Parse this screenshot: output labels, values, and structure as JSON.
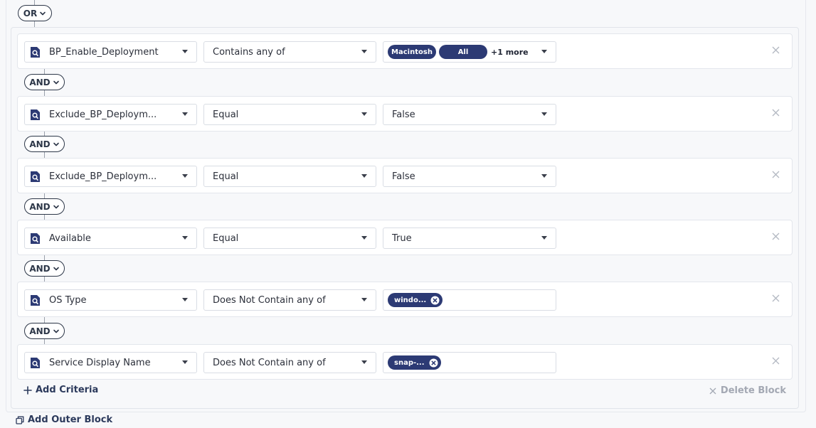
{
  "top_logic": "OR",
  "criteria": [
    {
      "attribute": "BP_Enable_Deployment",
      "operator": "Contains any of",
      "chips": [
        "Macintosh",
        "All"
      ],
      "more": "+1 more",
      "value": ""
    },
    {
      "join": "AND",
      "attribute": "Exclude_BP_Deploym...",
      "operator": "Equal",
      "value": "False"
    },
    {
      "join": "AND",
      "attribute": "Exclude_BP_Deploym...",
      "operator": "Equal",
      "value": "False"
    },
    {
      "join": "AND",
      "attribute": "Available",
      "operator": "Equal",
      "value": "True"
    },
    {
      "join": "AND",
      "attribute": "OS Type",
      "operator": "Does Not Contain any of",
      "chips": [
        "windo..."
      ],
      "value": ""
    },
    {
      "join": "AND",
      "attribute": "Service Display Name",
      "operator": "Does Not Contain any of",
      "chips": [
        "snap-..."
      ],
      "value": ""
    }
  ],
  "actions": {
    "add_criteria": "Add Criteria",
    "delete_block": "Delete Block",
    "add_outer_block": "Add Outer Block"
  },
  "icons": {
    "attribute": "attribute-search-icon",
    "remove": "close-icon",
    "chevron": "chevron-down-icon",
    "add": "plus-icon",
    "outer": "copy-block-icon"
  },
  "colors": {
    "chip_bg": "#2c3a74",
    "pill_border": "#2d3748",
    "link": "#2c3a5c",
    "muted": "#a3a8b3"
  }
}
